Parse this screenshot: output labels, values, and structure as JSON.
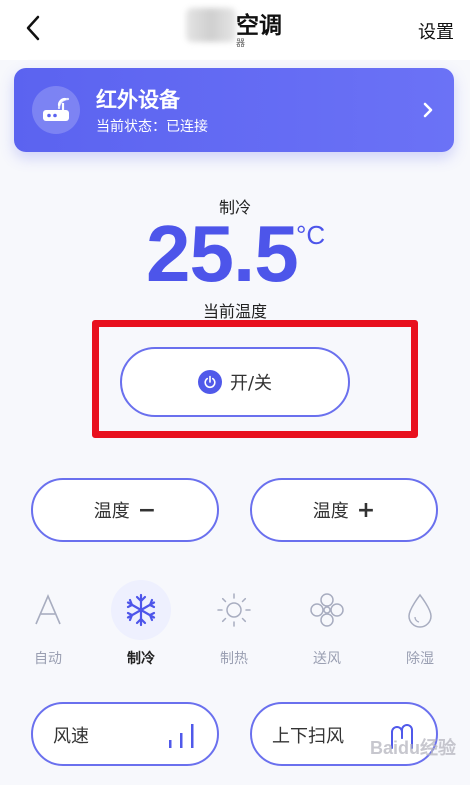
{
  "header": {
    "title": "空调",
    "subtitle": "器",
    "settings_label": "设置"
  },
  "device_card": {
    "name": "红外设备",
    "status": "当前状态：已连接"
  },
  "climate": {
    "mode": "制冷",
    "temperature": "25.5",
    "unit": "°C",
    "caption": "当前温度"
  },
  "controls": {
    "power_label": "开/关",
    "temp_minus_label": "温度",
    "temp_minus_symbol": "−",
    "temp_plus_label": "温度",
    "temp_plus_symbol": "+"
  },
  "modes": [
    {
      "label": "自动",
      "icon": "auto-icon",
      "active": false
    },
    {
      "label": "制冷",
      "icon": "snowflake-icon",
      "active": true
    },
    {
      "label": "制热",
      "icon": "sun-icon",
      "active": false
    },
    {
      "label": "送风",
      "icon": "fan-icon",
      "active": false
    },
    {
      "label": "除湿",
      "icon": "droplet-icon",
      "active": false
    }
  ],
  "bottom": {
    "fan_speed_label": "风速",
    "swing_label": "上下扫风"
  },
  "watermark": "Baidu经验",
  "colors": {
    "accent": "#5059ea",
    "highlight": "#e8101e",
    "inactive": "#9a9fb2"
  }
}
